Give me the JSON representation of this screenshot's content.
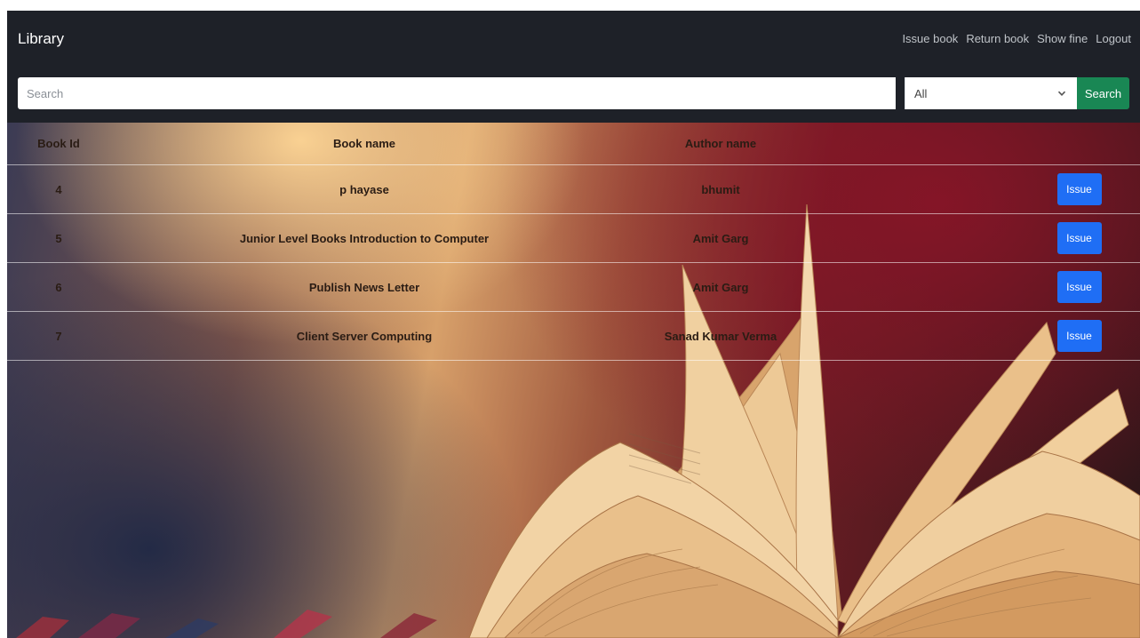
{
  "navbar": {
    "brand": "Library",
    "links": [
      "Issue book",
      "Return book",
      "Show fine",
      "Logout"
    ]
  },
  "search": {
    "placeholder": "Search",
    "category_selected": "All",
    "button_label": "Search"
  },
  "table": {
    "headers": [
      "Book Id",
      "Book name",
      "Author name",
      "",
      ""
    ],
    "rows": [
      {
        "id": "4",
        "name": "p hayase",
        "author": "bhumit",
        "availability": "",
        "action": "Issue"
      },
      {
        "id": "5",
        "name": "Junior Level Books Introduction to Computer",
        "author": "Amit Garg",
        "availability": "",
        "action": "Issue"
      },
      {
        "id": "6",
        "name": "Publish News Letter",
        "author": "Amit Garg",
        "availability": "",
        "action": "Issue"
      },
      {
        "id": "7",
        "name": "Client Server Computing",
        "author": "Sanad Kumar Verma",
        "availability": "",
        "action": "Issue"
      }
    ]
  },
  "colors": {
    "navbar_bg": "#1e2128",
    "search_button": "#198754",
    "issue_button": "#1f6ef5"
  },
  "icons": {
    "select_arrow": "chevron-down-icon",
    "background": "open-book-illustration"
  }
}
